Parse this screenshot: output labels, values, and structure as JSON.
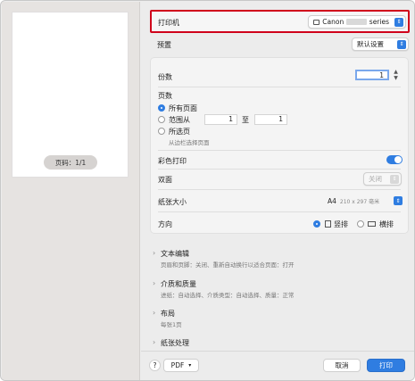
{
  "preview": {
    "page_label": "页码：1/1"
  },
  "printer": {
    "label": "打印机",
    "brand": "Canon",
    "suffix": "series"
  },
  "preset": {
    "label": "预置",
    "value": "默认设置"
  },
  "copies": {
    "label": "份数",
    "value": "1"
  },
  "pages": {
    "label": "页数",
    "all_label": "所有页面",
    "range_label": "范围从",
    "range_from": "1",
    "range_to_label": "至",
    "range_to": "1",
    "selection_label": "所选页",
    "selection_hint": "从边栏选择页面"
  },
  "color": {
    "label": "彩色打印",
    "on": true
  },
  "duplex": {
    "label": "双面",
    "value": "关闭"
  },
  "paper": {
    "label": "纸张大小",
    "value": "A4",
    "dims": "210 x 297 毫米"
  },
  "orientation": {
    "label": "方向",
    "portrait": "竖排",
    "landscape": "横排",
    "selected": "portrait"
  },
  "sections": [
    {
      "title": "文本编辑",
      "detail": "页眉和页脚：关闭、重新自动换行以适合页面：打开"
    },
    {
      "title": "介质和质量",
      "detail": "进纸：自动选择、介质类型：自动选择、质量：正常"
    },
    {
      "title": "布局",
      "detail": "每张1页"
    },
    {
      "title": "纸张处理",
      "detail": ""
    }
  ],
  "footer": {
    "help": "?",
    "pdf": "PDF",
    "cancel": "取消",
    "print": "打印"
  },
  "colors": {
    "accent": "#2f7de1",
    "highlight_border": "#d0021b"
  }
}
